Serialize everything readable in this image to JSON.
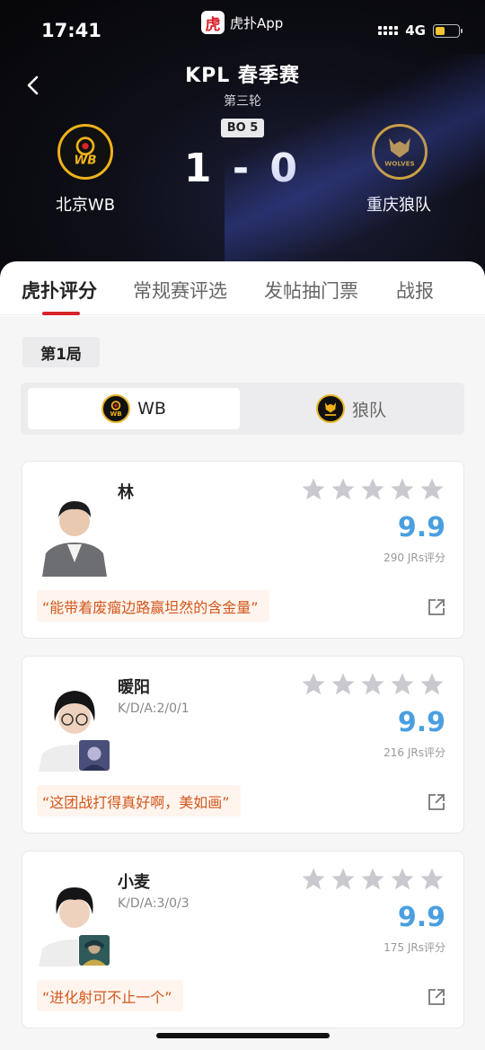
{
  "status_bar": {
    "time": "17:41",
    "app_name": "虎扑App",
    "app_logo_char": "虎",
    "network": "4G",
    "battery_level": 0.4
  },
  "match": {
    "title": "KPL 春季赛",
    "round": "第三轮",
    "format": "BO 5",
    "score": "1 - 0",
    "home_team": {
      "name": "北京WB",
      "logo_text": "WB",
      "color": "#f0b21a"
    },
    "away_team": {
      "name": "重庆狼队",
      "logo_text": "WOLVES",
      "color": "#f0b21a"
    }
  },
  "tabs": [
    {
      "label": "虎扑评分",
      "active": true
    },
    {
      "label": "常规赛评选",
      "active": false
    },
    {
      "label": "发帖抽门票",
      "active": false
    },
    {
      "label": "战报",
      "active": false
    }
  ],
  "game_label": "第1局",
  "team_switch": {
    "home_label": "WB",
    "away_label": "狼队"
  },
  "players": [
    {
      "name": "林",
      "kda": "",
      "rating": "9.9",
      "votes": "290 JRs评分",
      "quote": "“能带着废瘤边路赢坦然的含金量”",
      "stars": 0
    },
    {
      "name": "暖阳",
      "kda": "K/D/A:2/0/1",
      "rating": "9.9",
      "votes": "216 JRs评分",
      "quote": "“这团战打得真好啊，美如画”",
      "stars": 0
    },
    {
      "name": "小麦",
      "kda": "K/D/A:3/0/3",
      "rating": "9.9",
      "votes": "175 JRs评分",
      "quote": "“进化射可不止一个”",
      "stars": 0
    }
  ],
  "colors": {
    "accent": "#d8232a",
    "rating": "#4a9fe0",
    "quote_text": "#d2571d",
    "star_empty": "#c9c9cf"
  }
}
